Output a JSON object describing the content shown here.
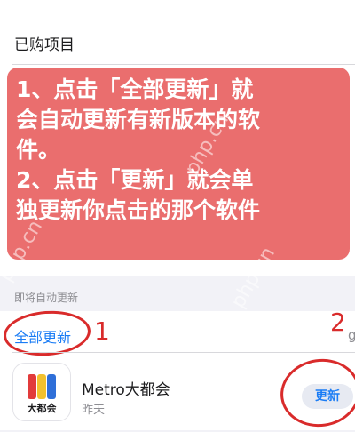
{
  "section": {
    "title": "已购项目",
    "footer": "即将自动更新"
  },
  "annotation": {
    "lines": [
      "1、点击「全部更新」就",
      "会自动更新有新版本的软",
      "件。",
      "2、点击「更新」就会单",
      "独更新你点击的那个软件"
    ],
    "watermark": "php.cn",
    "marker_1": "1",
    "marker_2": "2",
    "color": "#d92b2b"
  },
  "update_all": {
    "label": "全部更新"
  },
  "app": {
    "name": "Metro大都会",
    "date": "昨天",
    "icon_label": "大都会",
    "update_label": "更新"
  },
  "edge_text": "g",
  "colors": {
    "accent": "#1a7cf5",
    "overlay": "#e75656"
  }
}
